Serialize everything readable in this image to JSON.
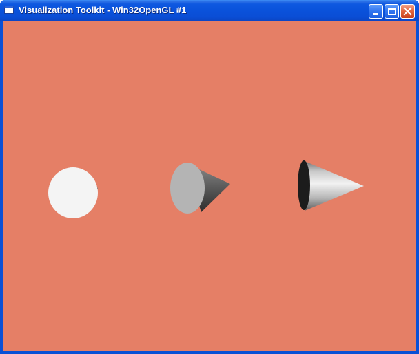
{
  "window": {
    "title": "Visualization Toolkit - Win32OpenGL #1",
    "app_icon": "window-icon",
    "controls": {
      "minimize": "minimize-icon",
      "maximize": "maximize-icon",
      "close": "close-icon"
    }
  },
  "scene": {
    "background_color": "#e57f66",
    "objects": [
      {
        "name": "cone-facing-viewer",
        "kind": "cone",
        "icon": "cone-icon"
      },
      {
        "name": "cone-rotated",
        "kind": "cone",
        "icon": "cone-icon"
      },
      {
        "name": "cone-side-view",
        "kind": "cone",
        "icon": "cone-icon"
      }
    ]
  },
  "colors": {
    "titlebar": "#0a52db",
    "viewport_background": "#e57f66",
    "close_button": "#e2673f"
  }
}
